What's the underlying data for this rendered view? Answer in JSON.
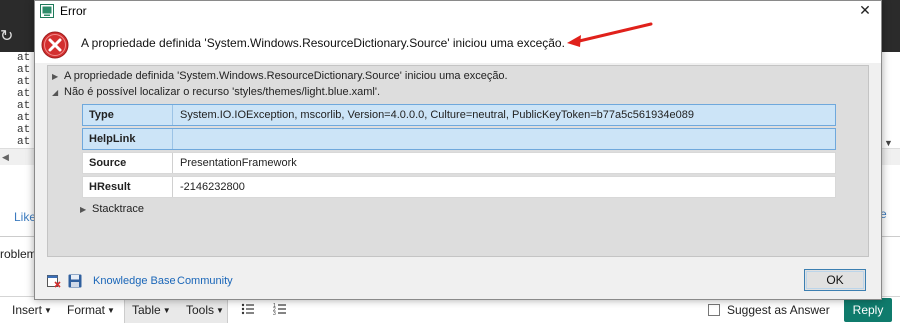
{
  "background": {
    "code_lines": [
      "at",
      "at",
      "at",
      "at",
      "at",
      "at",
      "at",
      "at"
    ],
    "like_text": "Like",
    "right_letter": "e",
    "problem_text": "roblem",
    "toolbar": {
      "insert": "Insert",
      "format": "Format",
      "table": "Table",
      "tools": "Tools",
      "suggest": "Suggest as Answer",
      "reply": "Reply"
    }
  },
  "dialog": {
    "title": "Error",
    "header_message": "A propriedade definida 'System.Windows.ResourceDictionary.Source' iniciou uma exceção.",
    "tree": [
      {
        "text": "A propriedade definida 'System.Windows.ResourceDictionary.Source' iniciou uma exceção.",
        "expanded": false
      },
      {
        "text": "Não é possível localizar o recurso 'styles/themes/light.blue.xaml'.",
        "expanded": true
      }
    ],
    "properties": [
      {
        "key": "Type",
        "value": "System.IO.IOException, mscorlib, Version=4.0.0.0, Culture=neutral, PublicKeyToken=b77a5c561934e089",
        "selected": true
      },
      {
        "key": "HelpLink",
        "value": "",
        "selected": true
      },
      {
        "key": "Source",
        "value": "PresentationFramework",
        "selected": false
      },
      {
        "key": "HResult",
        "value": "-2146232800",
        "selected": false
      }
    ],
    "stacktrace_label": "Stacktrace",
    "footer": {
      "knowledge_base": "Knowledge Base",
      "community": "Community",
      "ok": "OK"
    }
  },
  "colors": {
    "error_red": "#d32f2f",
    "arrow_red": "#e0211b",
    "link_blue": "#1a66b8",
    "selection": "#cce4f7",
    "reply_green": "#0f7b6c"
  }
}
